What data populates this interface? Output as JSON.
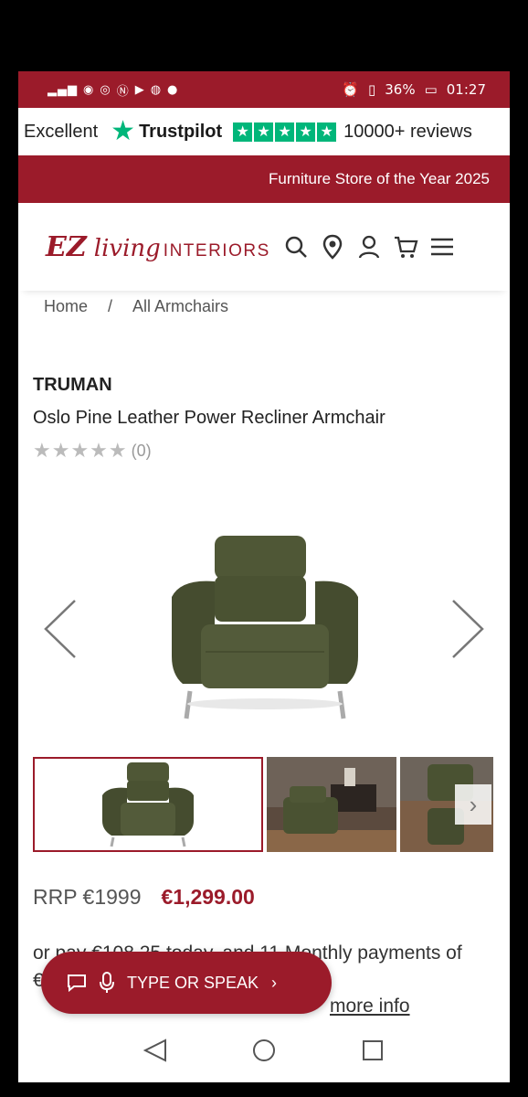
{
  "status_bar": {
    "battery": "36%",
    "time": "01:27"
  },
  "trustpilot": {
    "rating_word": "Excellent",
    "brand": "Trustpilot",
    "stars": 5,
    "reviews": "10000+ reviews"
  },
  "promo": {
    "text": "Furniture Store of the Year 2025"
  },
  "logo": {
    "ez": "EZ",
    "living": "living",
    "interiors": "INTERIORS"
  },
  "header_icons": [
    "search-icon",
    "location-pin-icon",
    "account-icon",
    "cart-icon",
    "menu-icon"
  ],
  "breadcrumb": {
    "home": "Home",
    "separator": "/",
    "current": "All Armchairs"
  },
  "product": {
    "brand": "TRUMAN",
    "title": "Oslo Pine Leather Power Recliner Armchair",
    "review_count": "(0)",
    "rating": 0,
    "rrp": "RRP €1999",
    "price": "€1,299.00",
    "installments": "or pay €108.25 today, and 11 Monthly payments of €108.25 Interest free with Klarna",
    "more_info": "more info"
  },
  "voice_pill": {
    "label": "TYPE OR SPEAK"
  },
  "colors": {
    "brand_red": "#9b1b2a",
    "trustpilot_green": "#00b67a",
    "leather_green": "#4a5232"
  }
}
